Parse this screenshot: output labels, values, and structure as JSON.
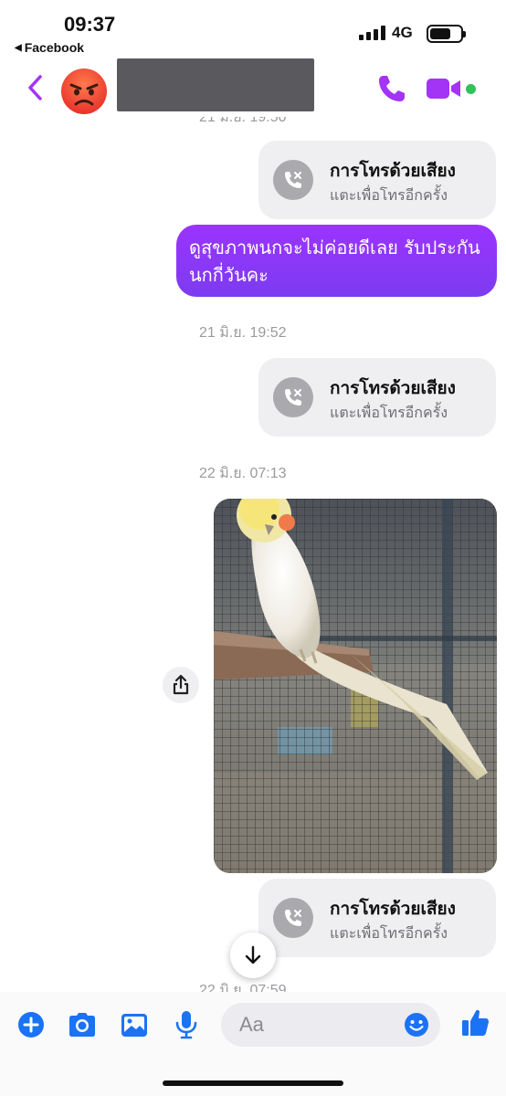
{
  "status_bar": {
    "time": "09:37",
    "back_app": "Facebook",
    "network": "4G"
  },
  "header": {
    "contact_avatar": "angry-face-emoji",
    "contact_name": "",
    "accent_color": "#a333f5",
    "online_color": "#31c25a"
  },
  "messages": {
    "ts_top_partial": "21 มิ.ย. 19:50",
    "call_1": {
      "title": "การโทรด้วยเสียง",
      "subtitle": "แตะเพื่อโทรอีกครั้ง"
    },
    "outgoing_text": "ดูสุขภาพนกจะไม่ค่อยดีเลย รับประกันนกกี่วันคะ",
    "ts_2": "21 มิ.ย. 19:52",
    "call_2": {
      "title": "การโทรด้วยเสียง",
      "subtitle": "แตะเพื่อโทรอีกครั้ง"
    },
    "ts_3": "22 มิ.ย. 07:13",
    "photo_subject": "cockatiel-in-cage",
    "call_3": {
      "title": "การโทรด้วยเสียง",
      "subtitle": "แตะเพื่อโทรอีกครั้ง"
    },
    "ts_bottom_partial": "22 มิ.ย. 07:59"
  },
  "composer": {
    "placeholder": "Aa",
    "icons": [
      "plus-icon",
      "camera-icon",
      "gallery-icon",
      "microphone-icon",
      "emoji-icon",
      "thumbs-up-icon"
    ],
    "icon_color": "#1a73f5"
  }
}
